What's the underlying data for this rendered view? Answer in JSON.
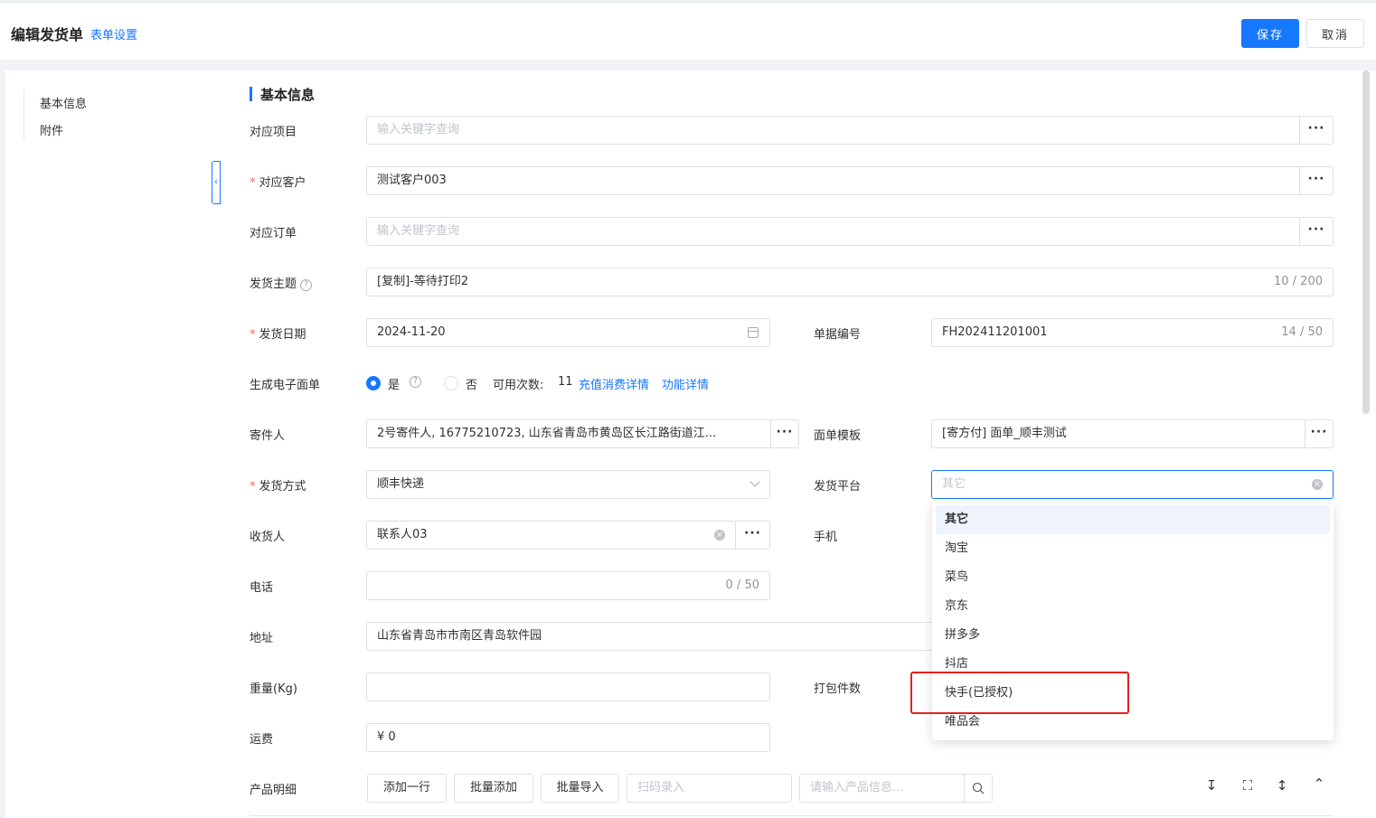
{
  "header": {
    "title": "编辑发货单",
    "form_settings": "表单设置",
    "save": "保存",
    "cancel": "取消"
  },
  "sidenav": {
    "items": [
      "基本信息",
      "附件"
    ]
  },
  "section": {
    "title": "基本信息"
  },
  "fields": {
    "project": {
      "label": "对应项目",
      "placeholder": "输入关键字查询"
    },
    "customer": {
      "label": "对应客户",
      "required": "*",
      "value": "测试客户003"
    },
    "order": {
      "label": "对应订单",
      "placeholder": "输入关键字查询"
    },
    "subject": {
      "label": "发货主题",
      "value": "[复制]-等待打印2",
      "counter": "10 / 200"
    },
    "ship_date": {
      "label": "发货日期",
      "required": "*",
      "value": "2024-11-20"
    },
    "doc_no": {
      "label": "单据编号",
      "value": "FH202411201001",
      "counter": "14 / 50"
    },
    "e_waybill": {
      "label": "生成电子面单",
      "yes": "是",
      "no": "否",
      "available": "可用次数:",
      "count": "11",
      "recharge_link": "充值消费详情",
      "feature_link": "功能详情"
    },
    "sender": {
      "label": "寄件人",
      "value": "2号寄件人, 16775210723, 山东省青岛市黄岛区长江路街道江..."
    },
    "template": {
      "label": "面单模板",
      "value": "[寄方付] 面单_顺丰测试"
    },
    "ship_method": {
      "label": "发货方式",
      "required": "*",
      "value": "顺丰快递"
    },
    "platform": {
      "label": "发货平台",
      "placeholder": "其它"
    },
    "receiver": {
      "label": "收货人",
      "value": "联系人03"
    },
    "mobile": {
      "label": "手机"
    },
    "phone": {
      "label": "电话",
      "counter": "0 / 50"
    },
    "address": {
      "label": "地址",
      "value": "山东省青岛市市南区青岛软件园"
    },
    "weight": {
      "label": "重量(Kg)"
    },
    "package_count": {
      "label": "打包件数"
    },
    "freight": {
      "label": "运费",
      "value": "¥ 0"
    },
    "products": {
      "label": "产品明细",
      "add_row": "添加一行",
      "batch_add": "批量添加",
      "batch_import": "批量导入",
      "scan_placeholder": "扫码录入",
      "search_placeholder": "请输入产品信息..."
    }
  },
  "platform_dropdown": {
    "options": [
      "其它",
      "淘宝",
      "菜鸟",
      "京东",
      "拼多多",
      "抖店",
      "快手(已授权)",
      "唯品会"
    ],
    "selected": "其它",
    "highlighted": "快手(已授权)"
  },
  "colors": {
    "primary": "#1677ff",
    "required": "#f56c6c",
    "highlight_box": "#e62020"
  }
}
